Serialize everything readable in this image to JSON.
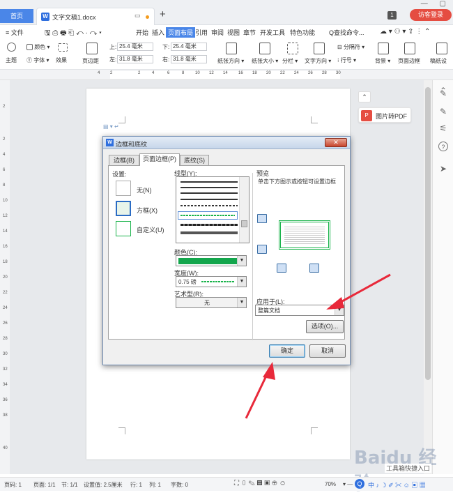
{
  "titlebar": {
    "home_tab": "首页",
    "doc_tab": "文字文稿1.docx",
    "new_tab": "+",
    "page_indicator": "1",
    "visitor_login": "访客登录"
  },
  "menubar": {
    "file": "≡ 文件",
    "items": [
      "开始",
      "插入",
      "页面布局",
      "引用",
      "审阅",
      "视图",
      "章节",
      "开发工具",
      "特色功能"
    ],
    "active": "页面布局",
    "search": "Q查找命令..."
  },
  "ribbon": {
    "theme": "主题",
    "colors": "颜色",
    "fonts": "字体",
    "effects": "效果",
    "margins": "页边距",
    "top_label": "上:",
    "top_value": "25.4 毫米",
    "bottom_label": "下:",
    "bottom_value": "25.4 毫米",
    "left_label": "左:",
    "left_value": "31.8 毫米",
    "right_label": "右:",
    "right_value": "31.8 毫米",
    "orientation": "纸张方向",
    "size": "纸张大小",
    "columns": "分栏",
    "text_direction": "文字方向",
    "breaks": "分隔符",
    "line_numbers": "行号",
    "background": "背景",
    "page_border": "页面边框",
    "paper": "稿纸设"
  },
  "ruler": {
    "ticks": [
      "4",
      "2",
      "",
      "2",
      "4",
      "6",
      "8",
      "10",
      "12",
      "14",
      "16",
      "18",
      "20",
      "22",
      "24",
      "26",
      "28",
      "30"
    ]
  },
  "vruler": {
    "ticks": [
      "2",
      "2",
      "4",
      "6",
      "8",
      "10",
      "12",
      "14",
      "16",
      "18",
      "20",
      "22",
      "24",
      "26",
      "28",
      "30",
      "32",
      "34",
      "36",
      "38",
      "40"
    ]
  },
  "side": {
    "pdf_label": "图片转PDF",
    "up_label": "⌃"
  },
  "dialog": {
    "title": "边框和底纹",
    "close": "✕",
    "tabs": [
      "边框(B)",
      "页面边框(P)",
      "底纹(S)"
    ],
    "setting_label": "设置:",
    "settings": [
      "无(N)",
      "方框(X)",
      "自定义(U)"
    ],
    "line_style_label": "线型(Y):",
    "color_label": "颜色(C):",
    "color_value": "#13a64c",
    "width_label": "宽度(W):",
    "width_value": "0.75 磅",
    "art_label": "艺术型(R):",
    "art_value": "无",
    "preview_label": "预览",
    "preview_hint": "单击下方图示或按钮可设置边框",
    "apply_label": "应用于(L):",
    "apply_value": "整篇文档",
    "options_button": "选项(O)...",
    "ok_button": "确定",
    "cancel_button": "取消"
  },
  "status": {
    "page": "页码: 1",
    "pages": "页面: 1/1",
    "section": "节: 1/1",
    "setting": "设置值: 2.5厘米",
    "row": "行: 1",
    "col": "列: 1",
    "words": "字数: 0",
    "zoom": "70%"
  },
  "watermark": {
    "brand": "Baidu 经验",
    "sub": "工具箱快捷入口"
  },
  "colors": {
    "accent": "#4a86e8",
    "visitor": "#e54d42",
    "green_border": "#13a64c",
    "arrow": "#e8293a"
  }
}
